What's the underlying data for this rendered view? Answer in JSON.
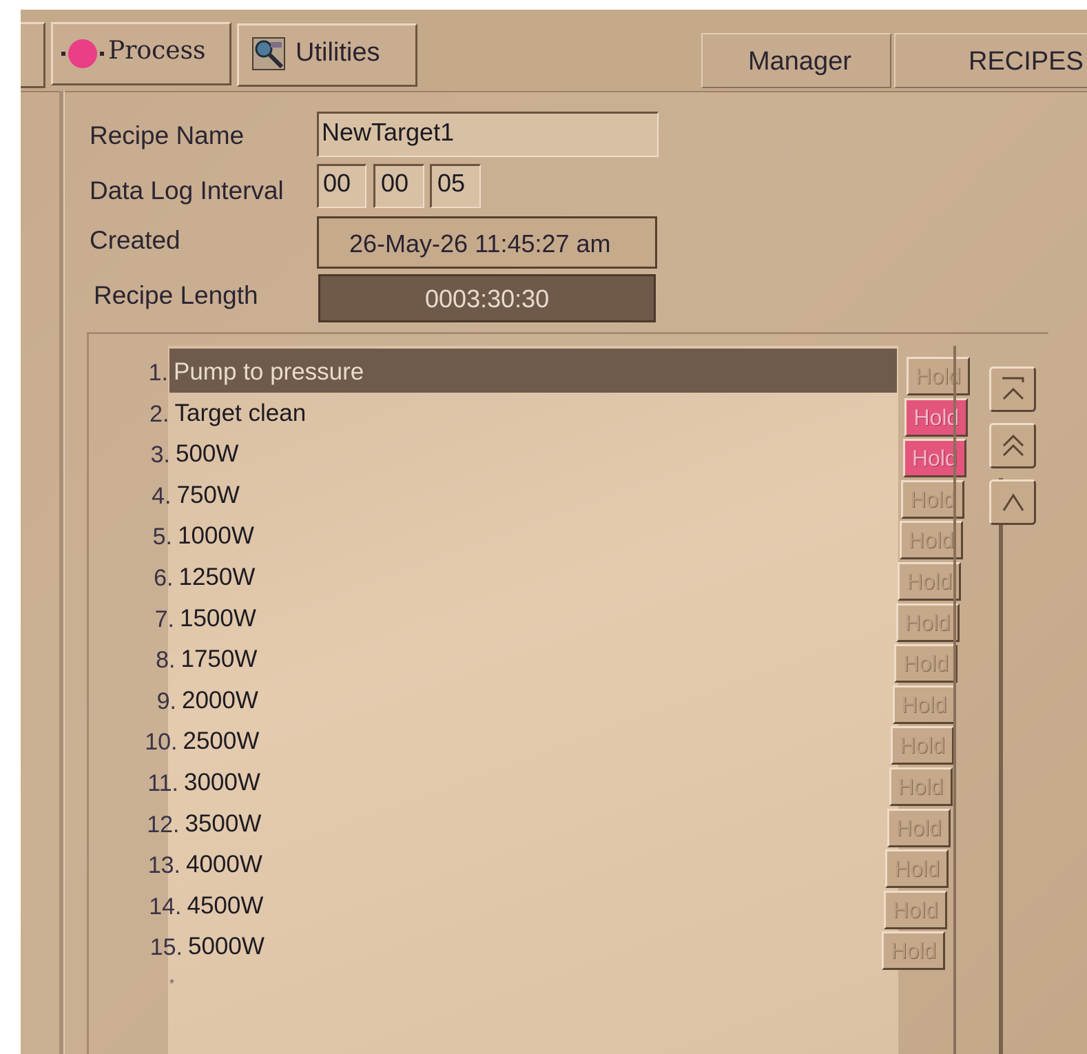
{
  "toolbar": {
    "process_label": "Process",
    "utilities_label": "Utilities",
    "process_icon": "record-dot-icon",
    "utilities_icon": "tools-icon"
  },
  "header": {
    "manager": "Manager",
    "recipes": "RECIPES"
  },
  "form": {
    "recipe_name_label": "Recipe Name",
    "recipe_name": "NewTarget1",
    "data_log_label": "Data Log Interval",
    "data_log_hours": "00",
    "data_log_minutes": "00",
    "data_log_seconds": "05",
    "created_label": "Created",
    "created_value": "26-May-26   11:45:27 am",
    "length_label": "Recipe Length",
    "length_value": "0003:30:30"
  },
  "steps": [
    {
      "num": "1.",
      "name": "Pump to pressure",
      "hold": "Hold",
      "hold_active": false,
      "selected": true
    },
    {
      "num": "2.",
      "name": "Target clean",
      "hold": "Hold",
      "hold_active": true
    },
    {
      "num": "3.",
      "name": "500W",
      "hold": "Hold",
      "hold_active": true
    },
    {
      "num": "4.",
      "name": "750W",
      "hold": "Hold",
      "hold_active": false
    },
    {
      "num": "5.",
      "name": "1000W",
      "hold": "Hold",
      "hold_active": false
    },
    {
      "num": "6.",
      "name": "1250W",
      "hold": "Hold",
      "hold_active": false
    },
    {
      "num": "7.",
      "name": "1500W",
      "hold": "Hold",
      "hold_active": false
    },
    {
      "num": "8.",
      "name": "1750W",
      "hold": "Hold",
      "hold_active": false
    },
    {
      "num": "9.",
      "name": "2000W",
      "hold": "Hold",
      "hold_active": false
    },
    {
      "num": "10.",
      "name": "2500W",
      "hold": "Hold",
      "hold_active": false
    },
    {
      "num": "11.",
      "name": "3000W",
      "hold": "Hold",
      "hold_active": false
    },
    {
      "num": "12.",
      "name": "3500W",
      "hold": "Hold",
      "hold_active": false
    },
    {
      "num": "13.",
      "name": "4000W",
      "hold": "Hold",
      "hold_active": false
    },
    {
      "num": "14.",
      "name": "4500W",
      "hold": "Hold",
      "hold_active": false
    },
    {
      "num": "15.",
      "name": "5000W",
      "hold": "Hold",
      "hold_active": false
    }
  ],
  "new_row_marker": "*",
  "nav": {
    "top_icon": "move-to-top-icon",
    "page_up_icon": "page-up-icon",
    "up_icon": "move-up-icon"
  },
  "colors": {
    "hold_active": "#e4557c",
    "selected_row": "#6e5b4b",
    "panel": "#c7ab8e"
  }
}
